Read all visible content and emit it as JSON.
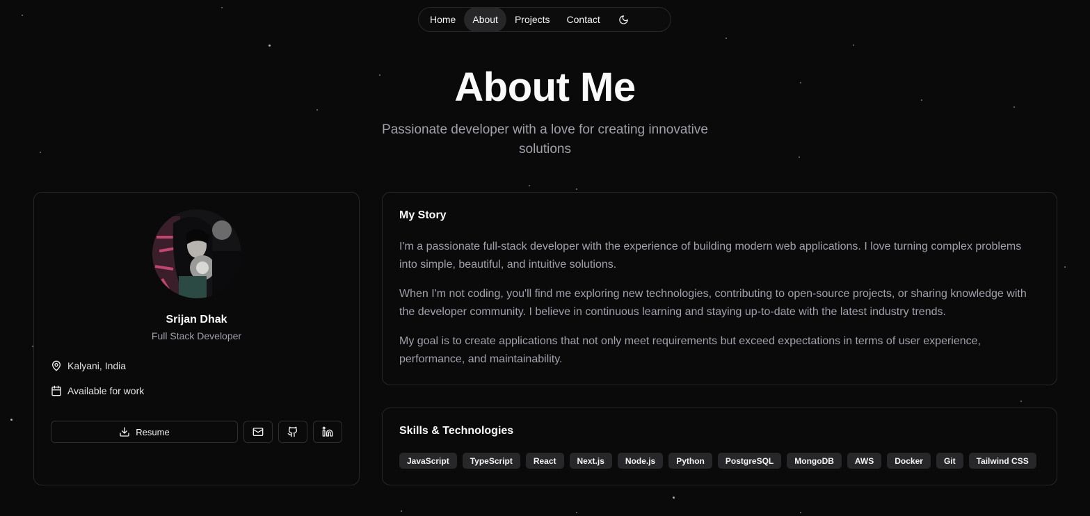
{
  "nav": {
    "items": [
      {
        "label": "Home",
        "active": false
      },
      {
        "label": "About",
        "active": true
      },
      {
        "label": "Projects",
        "active": false
      },
      {
        "label": "Contact",
        "active": false
      }
    ],
    "theme_icon": "moon-icon"
  },
  "hero": {
    "title": "About Me",
    "subtitle": "Passionate developer with a love for creating innovative solutions"
  },
  "profile": {
    "name": "Srijan Dhak",
    "role": "Full Stack Developer",
    "location": "Kalyani, India",
    "location_icon": "map-pin-icon",
    "availability": "Available for work",
    "availability_icon": "calendar-icon",
    "resume_label": "Resume",
    "resume_icon": "download-icon",
    "social_icons": [
      "mail-icon",
      "github-icon",
      "linkedin-icon"
    ]
  },
  "story": {
    "title": "My Story",
    "paragraphs": [
      "I'm a passionate full-stack developer with the experience of building modern web applications. I love turning complex problems into simple, beautiful, and intuitive solutions.",
      "When I'm not coding, you'll find me exploring new technologies, contributing to open-source projects, or sharing knowledge with the developer community. I believe in continuous learning and staying up-to-date with the latest industry trends.",
      "My goal is to create applications that not only meet requirements but exceed expectations in terms of user experience, performance, and maintainability."
    ]
  },
  "skills": {
    "title": "Skills & Technologies",
    "items": [
      "JavaScript",
      "TypeScript",
      "React",
      "Next.js",
      "Node.js",
      "Python",
      "PostgreSQL",
      "MongoDB",
      "AWS",
      "Docker",
      "Git",
      "Tailwind CSS"
    ]
  },
  "colors": {
    "background": "#0a0a0b",
    "card_border": "#27272a",
    "muted_text": "#a1a1aa",
    "chip_bg": "#27272a"
  }
}
